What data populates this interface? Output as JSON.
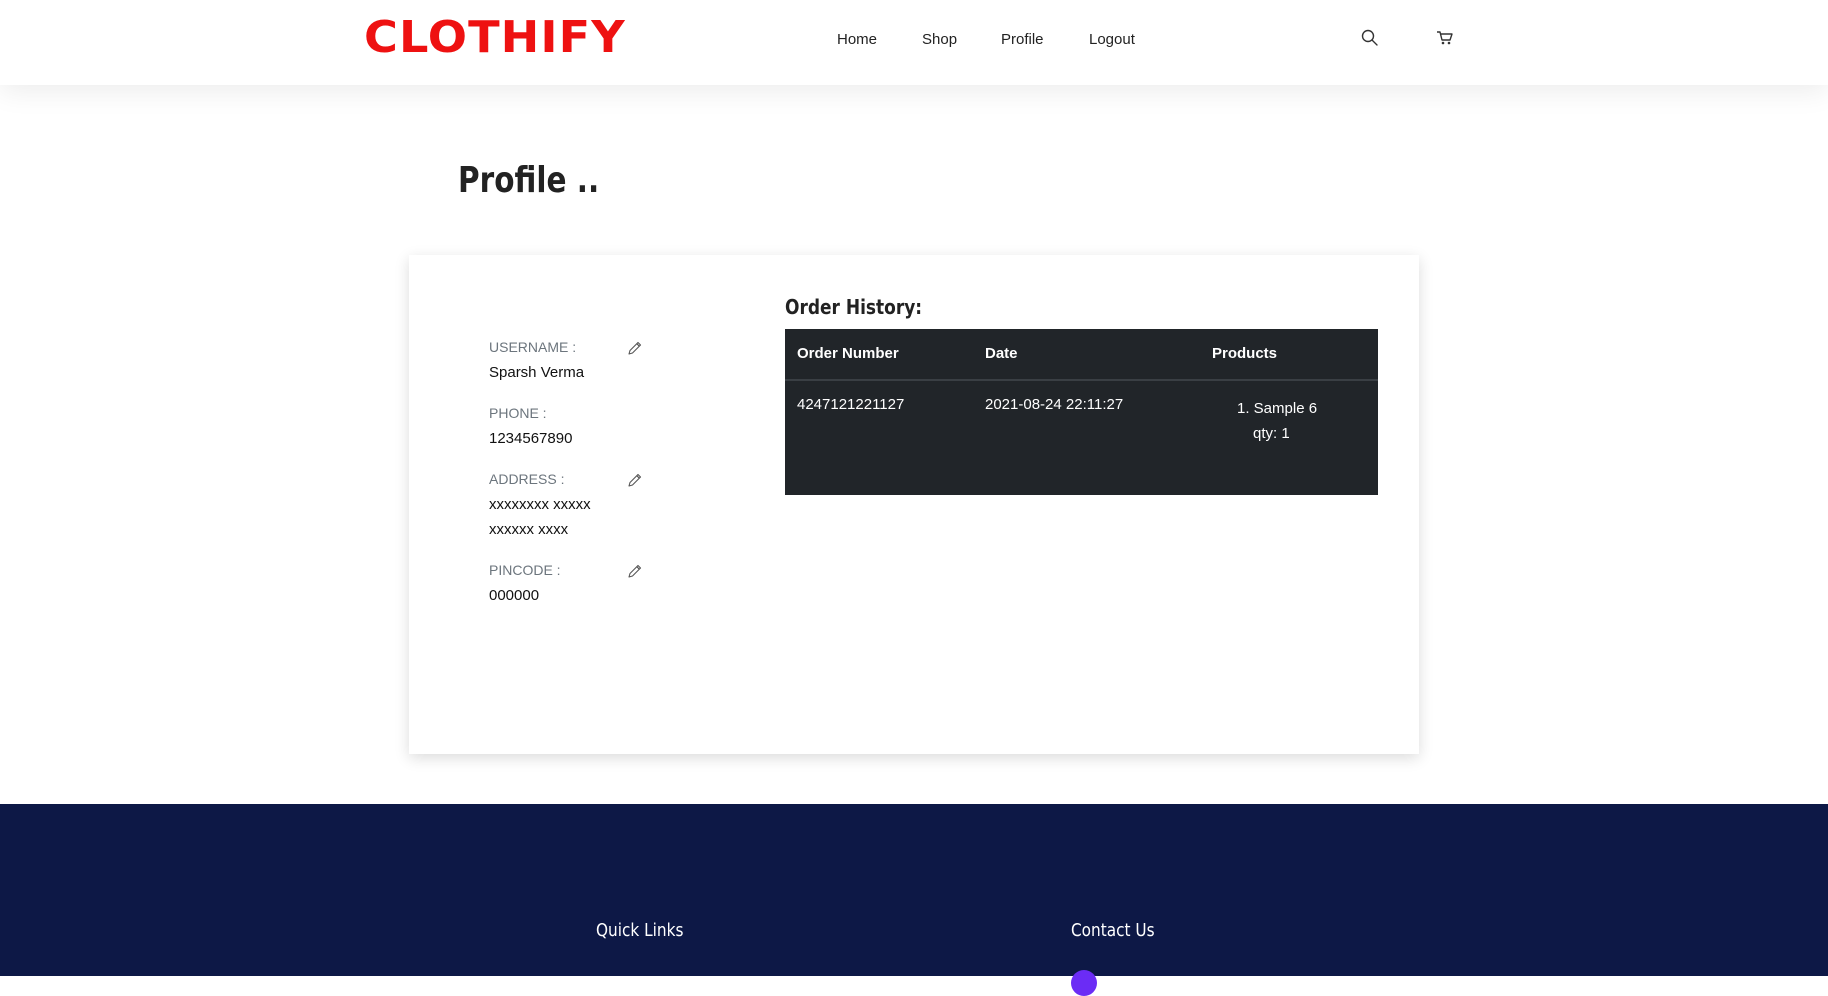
{
  "brand": {
    "logo_text": "CLOTHIFY",
    "logo_color": "#ee1111"
  },
  "nav": {
    "items": [
      {
        "label": "Home"
      },
      {
        "label": "Shop"
      },
      {
        "label": "Profile"
      },
      {
        "label": "Logout"
      }
    ],
    "icons": [
      "search-icon",
      "cart-icon"
    ]
  },
  "page": {
    "title": "Profile .."
  },
  "profile": {
    "username": {
      "label": "USERNAME :",
      "value": "Sparsh Verma",
      "editable": true
    },
    "phone": {
      "label": "PHONE :",
      "value": "1234567890",
      "editable": false
    },
    "address": {
      "label": "ADDRESS :",
      "line1": "xxxxxxxx xxxxx",
      "line2": "xxxxxx xxxx",
      "editable": true
    },
    "pincode": {
      "label": "PINCODE :",
      "value": "000000",
      "editable": true
    }
  },
  "orders": {
    "heading": "Order History:",
    "columns": [
      "Order Number",
      "Date",
      "Products"
    ],
    "rows": [
      {
        "order_number": "4247121221127",
        "date": "2021-08-24 22:11:27",
        "product_line": "1. Sample 6",
        "qty_line": "qty: 1"
      }
    ]
  },
  "footer": {
    "background": "#0d1846",
    "quick_links_heading": "Quick Links",
    "contact_heading": "Contact Us"
  }
}
